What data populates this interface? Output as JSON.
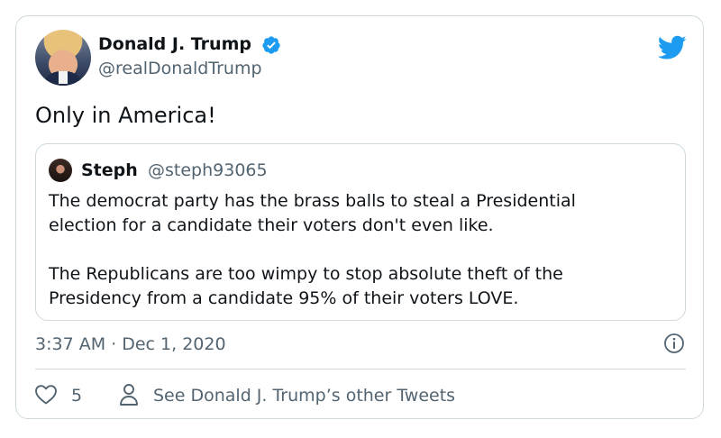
{
  "author": {
    "name": "Donald J. Trump",
    "handle": "@realDonaldTrump"
  },
  "tweet": {
    "text": "Only in America!",
    "timestamp": "3:37 AM · Dec 1, 2020"
  },
  "quoted": {
    "name": "Steph",
    "handle": "@steph93065",
    "paragraphs": [
      [
        "The democrat party has the brass balls to steal a Presidential",
        "election for a candidate their voters don't even like."
      ],
      [
        "The Republicans are too wimpy to stop absolute theft of the",
        "Presidency from a candidate 95% of their voters LOVE."
      ]
    ]
  },
  "actions": {
    "like_count": "5",
    "other_tweets_label": "See Donald J. Trump’s other Tweets"
  },
  "icons": {
    "verified": "verified-badge-icon",
    "twitter": "twitter-bird-icon",
    "like": "heart-icon",
    "info": "info-icon",
    "person": "person-icon"
  },
  "colors": {
    "twitter_blue": "#1d9bf0",
    "secondary_text": "#536471",
    "border": "#cfd9de"
  }
}
